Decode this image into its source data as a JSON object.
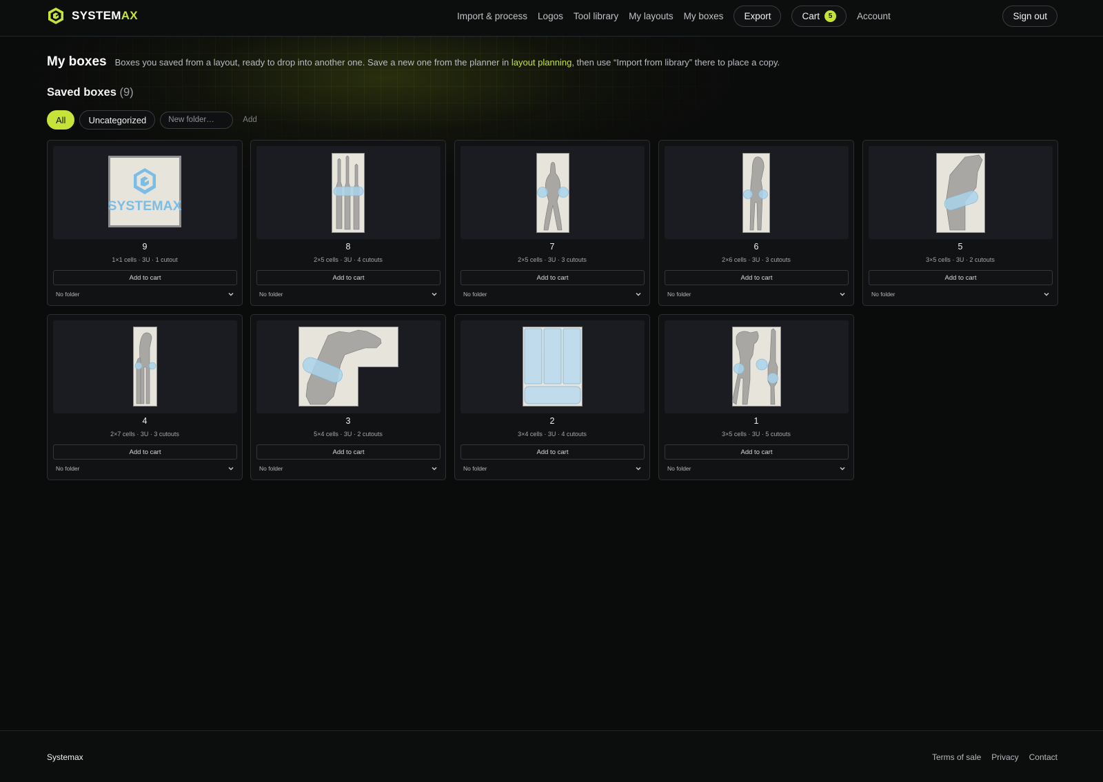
{
  "brand": {
    "name_main": "SYSTEM",
    "name_accent": "AX"
  },
  "nav": {
    "import": "Import & process",
    "logos": "Logos",
    "tools": "Tool library",
    "layouts": "My layouts",
    "boxes": "My boxes",
    "export": "Export",
    "cart": "Cart",
    "cart_count": "5",
    "account": "Account",
    "signout": "Sign out"
  },
  "page": {
    "title": "My boxes",
    "desc_before": "Boxes you saved from a layout, ready to drop into another one. Save a new one from the planner in ",
    "desc_link": "layout planning",
    "desc_after": ", then use “Import from library” there to place a copy."
  },
  "section": {
    "title": "Saved boxes",
    "count": "(9)"
  },
  "filters": {
    "all": "All",
    "uncategorized": "Uncategorized",
    "new_folder_placeholder": "New folder…",
    "add": "Add"
  },
  "boxes": [
    {
      "name": "9",
      "meta": "1×1 cells · 3U · 1 cutout",
      "add_to_cart": "Add to cart",
      "folder": "No folder",
      "logo_text": "SYSTEMAX"
    },
    {
      "name": "8",
      "meta": "2×5 cells · 3U · 4 cutouts",
      "add_to_cart": "Add to cart",
      "folder": "No folder"
    },
    {
      "name": "7",
      "meta": "2×5 cells · 3U · 3 cutouts",
      "add_to_cart": "Add to cart",
      "folder": "No folder"
    },
    {
      "name": "6",
      "meta": "2×6 cells · 3U · 3 cutouts",
      "add_to_cart": "Add to cart",
      "folder": "No folder"
    },
    {
      "name": "5",
      "meta": "3×5 cells · 3U · 2 cutouts",
      "add_to_cart": "Add to cart",
      "folder": "No folder"
    },
    {
      "name": "4",
      "meta": "2×7 cells · 3U · 3 cutouts",
      "add_to_cart": "Add to cart",
      "folder": "No folder"
    },
    {
      "name": "3",
      "meta": "5×4 cells · 3U · 2 cutouts",
      "add_to_cart": "Add to cart",
      "folder": "No folder"
    },
    {
      "name": "2",
      "meta": "3×4 cells · 3U · 4 cutouts",
      "add_to_cart": "Add to cart",
      "folder": "No folder"
    },
    {
      "name": "1",
      "meta": "3×5 cells · 3U · 5 cutouts",
      "add_to_cart": "Add to cart",
      "folder": "No folder"
    }
  ],
  "footer": {
    "brand": "Systemax",
    "terms": "Terms of sale",
    "privacy": "Privacy",
    "contact": "Contact"
  },
  "colors": {
    "accent": "#c6e33a",
    "background": "#0a0b0b",
    "card": "#111214",
    "foam": "#e7e4dc",
    "tool": "#a9a7a4",
    "finger_cutout": "#a9d3ea"
  }
}
